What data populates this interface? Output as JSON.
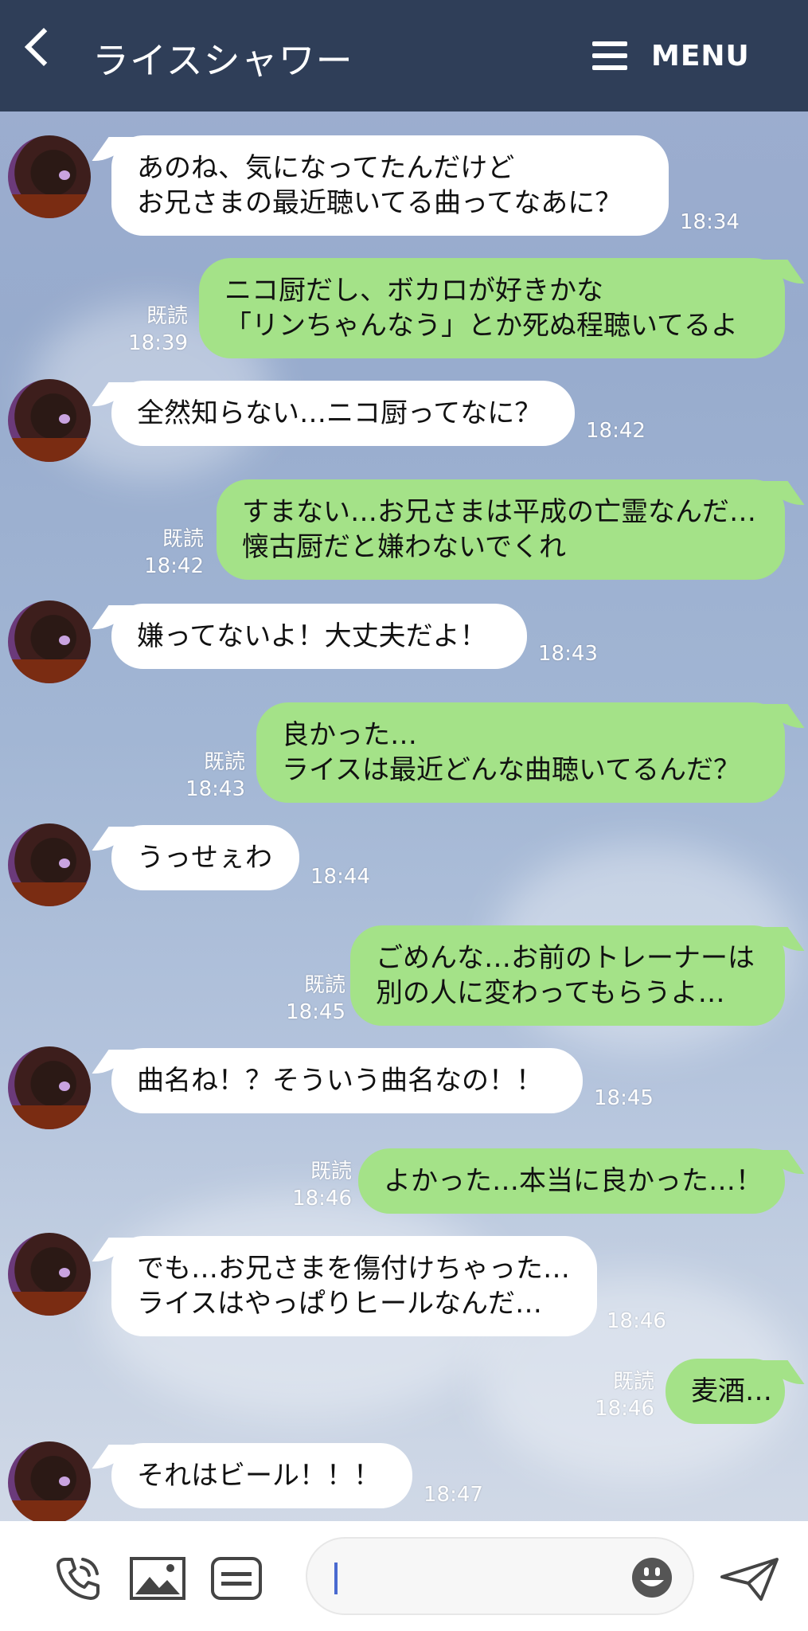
{
  "header": {
    "title": "ライスシャワー",
    "menu_label": "MENU"
  },
  "read_label": "既読",
  "messages": [
    {
      "side": "in",
      "text": "あのね、気になってたんだけど\nお兄さまの最近聴いてる曲ってなあに？",
      "time": "18:34"
    },
    {
      "side": "out",
      "text": "ニコ厨だし、ボカロが好きかな\n「リンちゃんなう」とか死ぬ程聴いてるよ",
      "time": "18:39",
      "read": true
    },
    {
      "side": "in",
      "text": "全然知らない…ニコ厨ってなに？",
      "time": "18:42"
    },
    {
      "side": "out",
      "text": "すまない…お兄さまは平成の亡霊なんだ…\n懐古厨だと嫌わないでくれ",
      "time": "18:42",
      "read": true
    },
    {
      "side": "in",
      "text": "嫌ってないよ！大丈夫だよ！",
      "time": "18:43"
    },
    {
      "side": "out",
      "text": "良かった…\nライスは最近どんな曲聴いてるんだ？",
      "time": "18:43",
      "read": true
    },
    {
      "side": "in",
      "text": "うっせぇわ",
      "time": "18:44"
    },
    {
      "side": "out",
      "text": "ごめんな…お前のトレーナーは\n別の人に変わってもらうよ…",
      "time": "18:45",
      "read": true
    },
    {
      "side": "in",
      "text": "曲名ね！？そういう曲名なの！！",
      "time": "18:45"
    },
    {
      "side": "out",
      "text": "よかった…本当に良かった…！",
      "time": "18:46",
      "read": true
    },
    {
      "side": "in",
      "text": "でも…お兄さまを傷付けちゃった…\nライスはやっぱりヒールなんだ…",
      "time": "18:46"
    },
    {
      "side": "out",
      "text": "麦酒…",
      "time": "18:46",
      "read": true
    },
    {
      "side": "in",
      "text": "それはビール！！！",
      "time": "18:47"
    }
  ],
  "footer": {
    "icons": [
      "phone-icon",
      "image-icon",
      "keyboard-icon",
      "emoji-icon",
      "send-icon"
    ],
    "input_value": ""
  },
  "colors": {
    "header_bg": "#2f3e58",
    "outgoing_bubble": "#a4e288",
    "incoming_bubble": "#ffffff"
  }
}
